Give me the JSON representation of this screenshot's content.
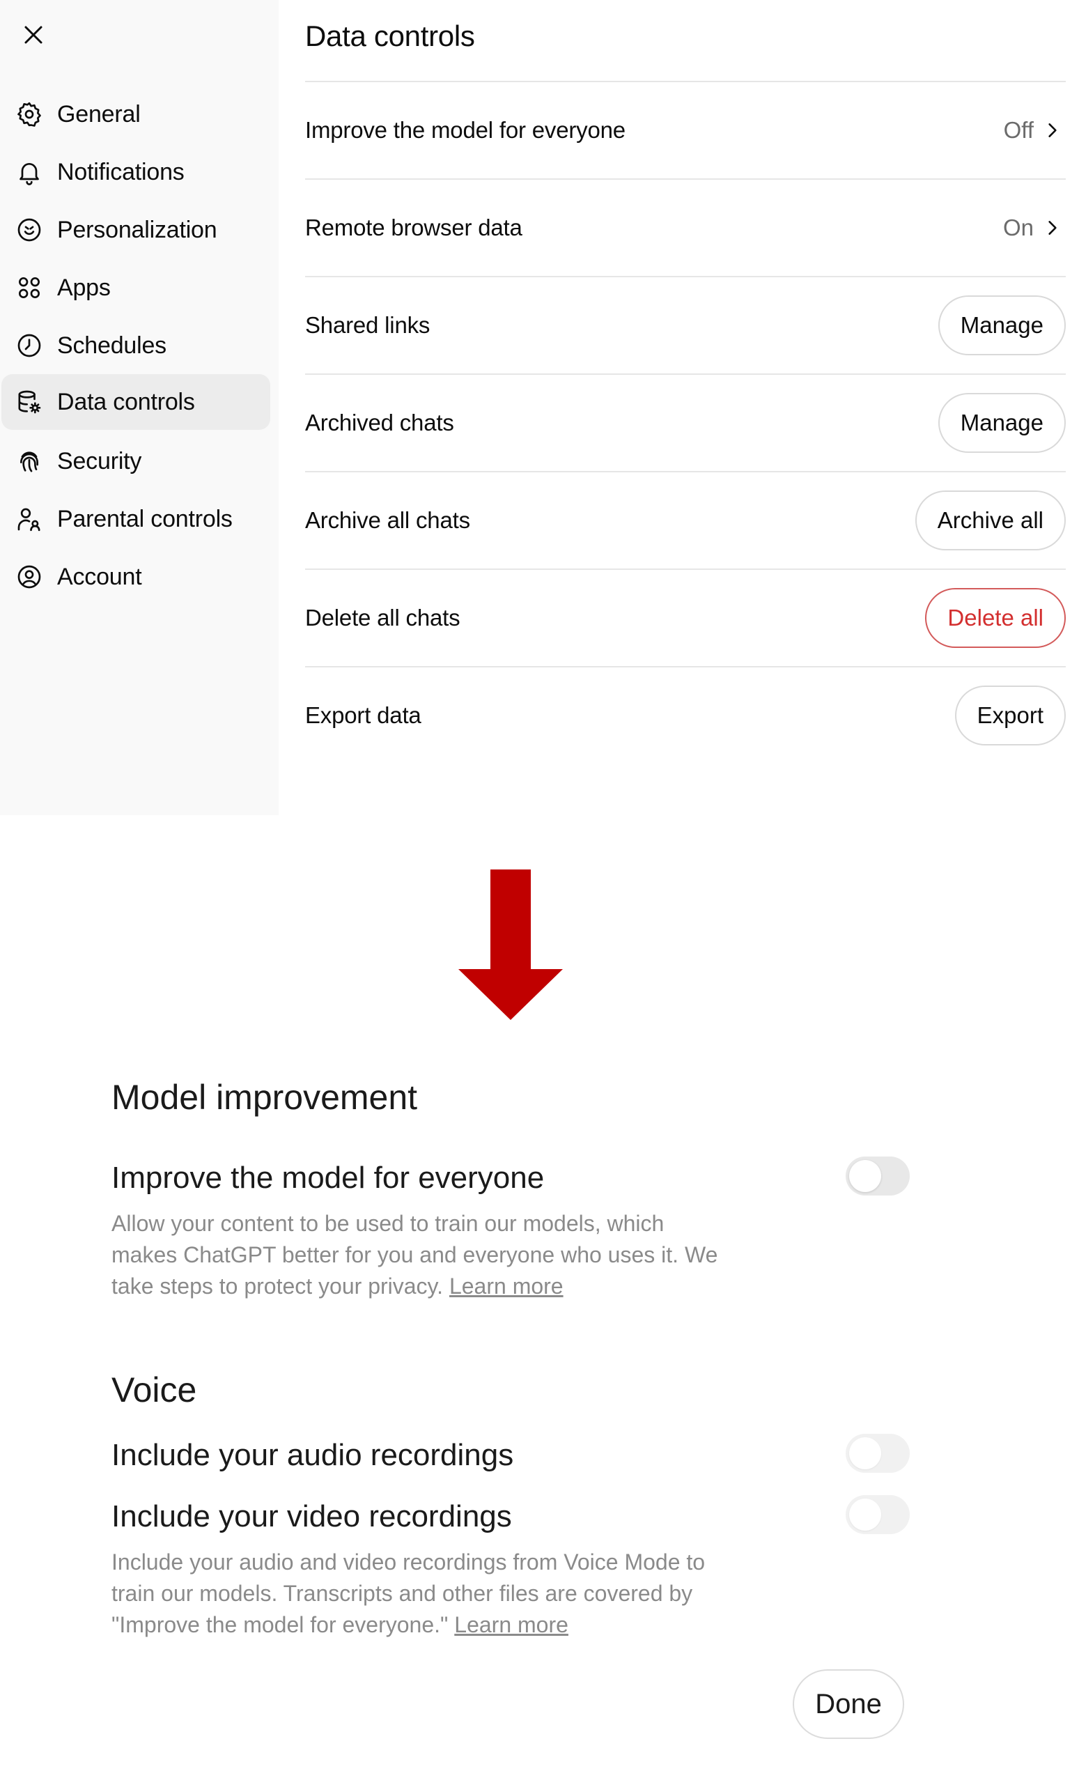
{
  "settings": {
    "close_icon": "close-icon",
    "nav": [
      {
        "label": "General",
        "icon": "gear-icon"
      },
      {
        "label": "Notifications",
        "icon": "bell-icon"
      },
      {
        "label": "Personalization",
        "icon": "personalization-icon"
      },
      {
        "label": "Apps",
        "icon": "apps-grid-icon"
      },
      {
        "label": "Schedules",
        "icon": "clock-icon"
      },
      {
        "label": "Data controls",
        "icon": "database-gear-icon",
        "active": true
      },
      {
        "label": "Security",
        "icon": "fingerprint-icon"
      },
      {
        "label": "Parental controls",
        "icon": "parent-icon"
      },
      {
        "label": "Account",
        "icon": "user-circle-icon"
      }
    ],
    "title": "Data controls",
    "rows": [
      {
        "label": "Improve the model for everyone",
        "value": "Off"
      },
      {
        "label": "Remote browser data",
        "value": "On"
      },
      {
        "label": "Shared links",
        "button": "Manage"
      },
      {
        "label": "Archived chats",
        "button": "Manage"
      },
      {
        "label": "Archive all chats",
        "button": "Archive all"
      },
      {
        "label": "Delete all chats",
        "button": "Delete all"
      },
      {
        "label": "Export data",
        "button": "Export"
      }
    ]
  },
  "colors": {
    "arrow": "#c00000",
    "danger": "#d32f2f",
    "sidebar_bg": "#f9f9f9",
    "active_bg": "#ececec"
  },
  "modal": {
    "model_section_title": "Model improvement",
    "improve_label": "Improve the model for everyone",
    "improve_toggle_on": false,
    "improve_desc": "Allow your content to be used to train our models, which makes ChatGPT better for you and everyone who uses it. We take steps to protect your privacy.",
    "learn_more": "Learn more",
    "voice_section_title": "Voice",
    "audio_label": "Include your audio recordings",
    "audio_toggle_on": false,
    "video_label": "Include your video recordings",
    "video_toggle_on": false,
    "voice_desc": "Include your audio and video recordings from Voice Mode to train our models. Transcripts and other files are covered by \"Improve the model for everyone.\"",
    "done_label": "Done"
  }
}
